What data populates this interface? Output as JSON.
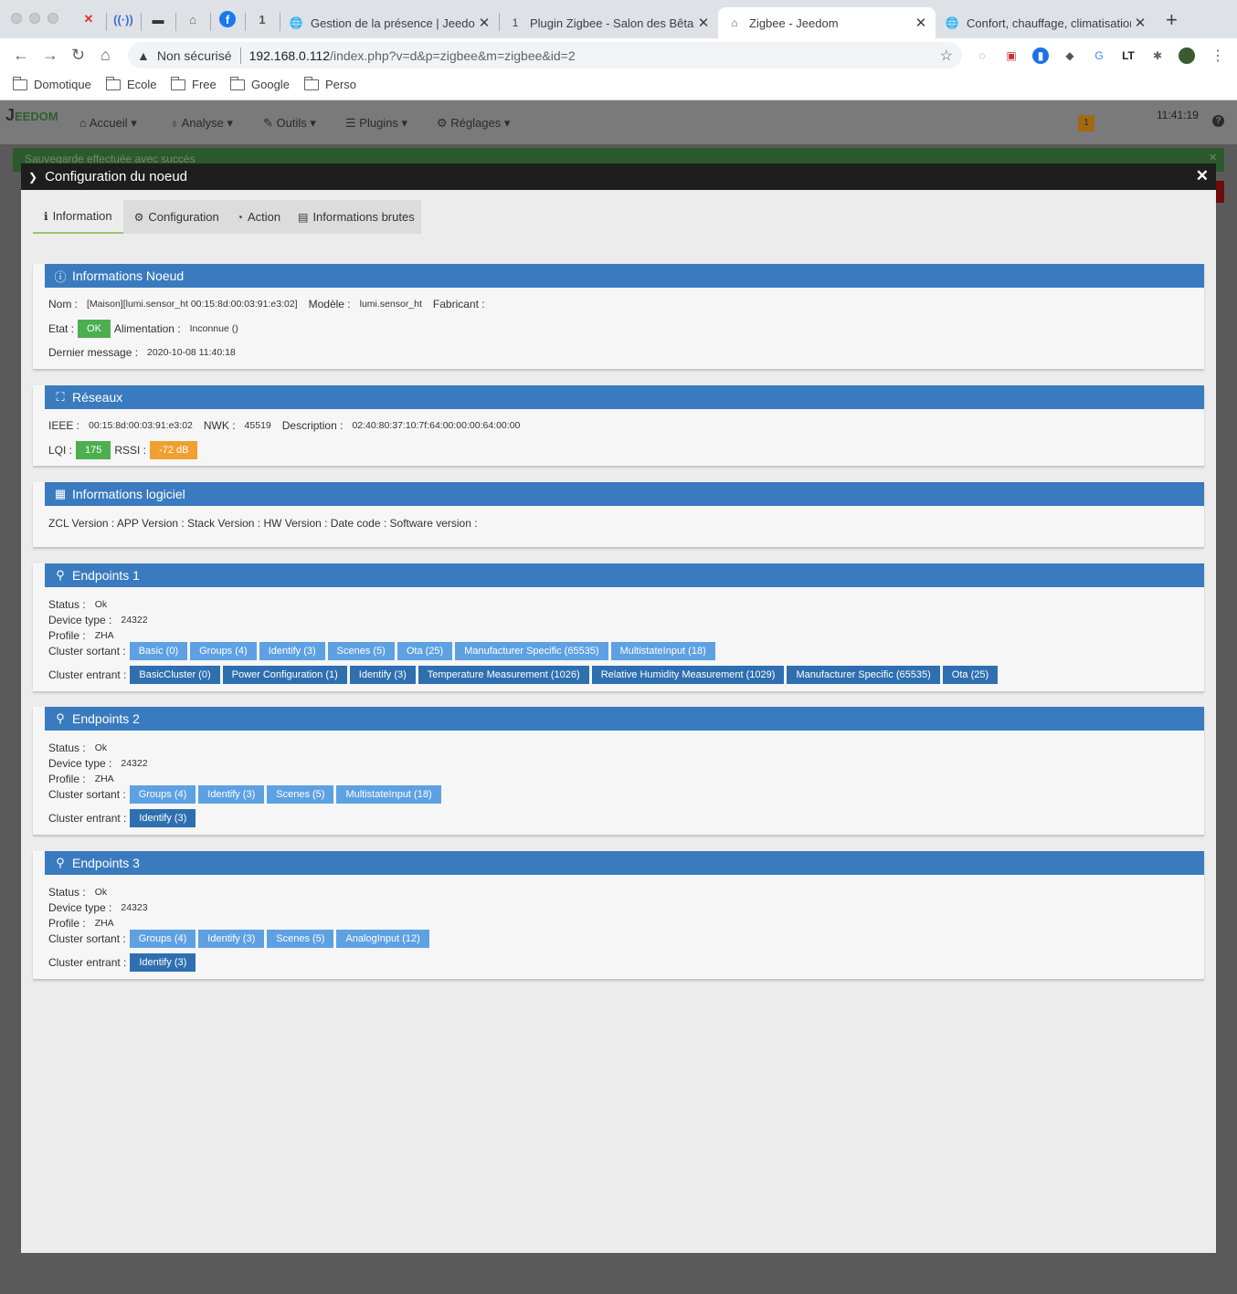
{
  "browser": {
    "tabs": [
      {
        "title": "Gestion de la présence | Jeedom",
        "active": false
      },
      {
        "title": "Plugin Zigbee - Salon des Bêtas",
        "active": false
      },
      {
        "title": "Zigbee - Jeedom",
        "active": true
      },
      {
        "title": "Confort, chauffage, climatisation",
        "active": false
      }
    ],
    "address": {
      "security": "Non sécurisé",
      "host": "192.168.0.112",
      "path": "/index.php?v=d&p=zigbee&m=zigbee&id=2"
    },
    "bookmarks": [
      "Domotique",
      "Ecole",
      "Free",
      "Google",
      "Perso"
    ]
  },
  "jeedom": {
    "logo": "EEDOM",
    "menu": [
      "Accueil",
      "Analyse",
      "Outils",
      "Plugins",
      "Réglages"
    ],
    "notif_count": "1",
    "time": "11:41:19",
    "success_message": "Sauvegarde effectuée avec succès"
  },
  "modal": {
    "title": "Configuration du noeud",
    "tabs": [
      "Information",
      "Configuration",
      "Action",
      "Informations brutes"
    ],
    "node_info": {
      "title": "Informations Noeud",
      "nom_label": "Nom :",
      "nom": "[Maison][lumi.sensor_ht 00:15:8d:00:03:91:e3:02]",
      "modele_label": "Modèle :",
      "modele": "lumi.sensor_ht",
      "fabricant_label": "Fabricant :",
      "etat_label": "Etat :",
      "etat": "OK",
      "alim_label": "Alimentation :",
      "alim": "Inconnue ()",
      "last_label": "Dernier message :",
      "last": "2020-10-08 11:40:18"
    },
    "network": {
      "title": "Réseaux",
      "ieee_label": "IEEE :",
      "ieee": "00:15:8d:00:03:91:e3:02",
      "nwk_label": "NWK :",
      "nwk": "45519",
      "desc_label": "Description :",
      "desc": "02:40:80:37:10:7f:64:00:00:00:64:00:00",
      "lqi_label": "LQI :",
      "lqi": "175",
      "rssi_label": "RSSI :",
      "rssi": "-72 dB"
    },
    "software": {
      "title": "Informations logiciel",
      "line": "ZCL Version : APP Version : Stack Version : HW Version : Date code : Software version :"
    },
    "labels": {
      "status": "Status :",
      "device_type": "Device type :",
      "profile": "Profile :",
      "out": "Cluster sortant :",
      "in": "Cluster entrant :"
    },
    "endpoints": [
      {
        "title": "Endpoints 1",
        "status": "Ok",
        "device_type": "24322",
        "profile": "ZHA",
        "out": [
          "Basic (0)",
          "Groups (4)",
          "Identify (3)",
          "Scenes (5)",
          "Ota (25)",
          "Manufacturer Specific (65535)",
          "MultistateInput (18)"
        ],
        "in": [
          "BasicCluster (0)",
          "Power Configuration (1)",
          "Identify (3)",
          "Temperature Measurement (1026)",
          "Relative Humidity Measurement (1029)",
          "Manufacturer Specific (65535)",
          "Ota (25)"
        ]
      },
      {
        "title": "Endpoints 2",
        "status": "Ok",
        "device_type": "24322",
        "profile": "ZHA",
        "out": [
          "Groups (4)",
          "Identify (3)",
          "Scenes (5)",
          "MultistateInput (18)"
        ],
        "in": [
          "Identify (3)"
        ]
      },
      {
        "title": "Endpoints 3",
        "status": "Ok",
        "device_type": "24323",
        "profile": "ZHA",
        "out": [
          "Groups (4)",
          "Identify (3)",
          "Scenes (5)",
          "AnalogInput (12)"
        ],
        "in": [
          "Identify (3)"
        ]
      }
    ]
  },
  "colors": {
    "panel_header": "#3a7bbf",
    "chip_light": "#5ea1e3",
    "chip_dark": "#2f6fb0",
    "ok_green": "#4caf50",
    "rssi_orange": "#f0a030"
  }
}
